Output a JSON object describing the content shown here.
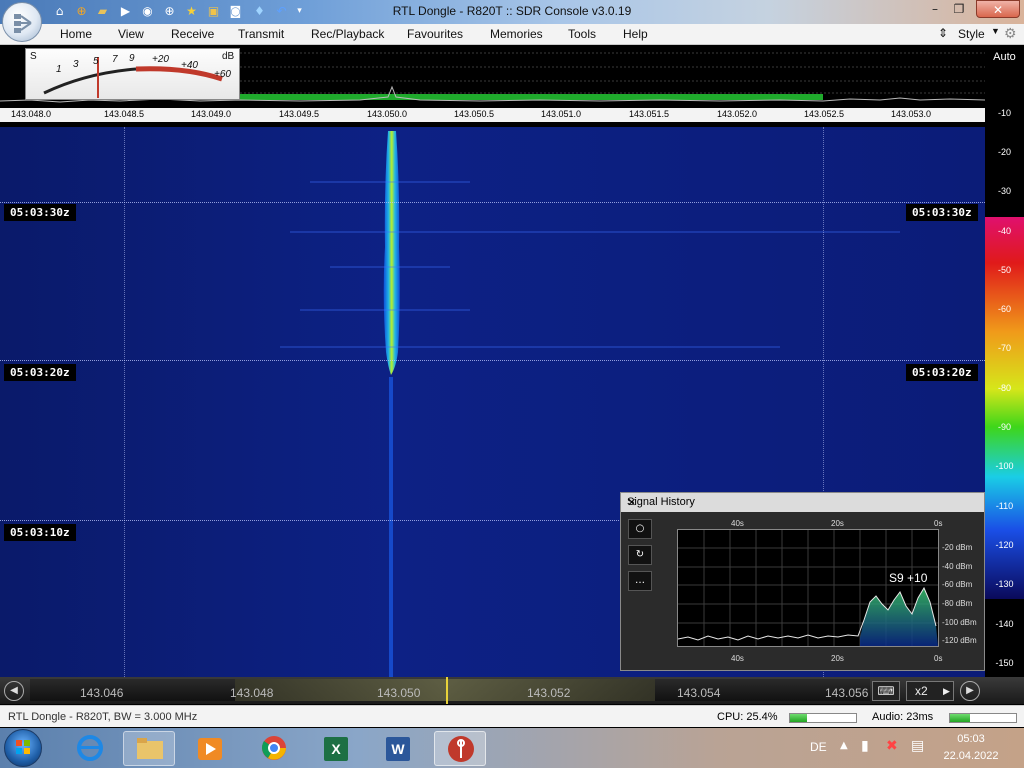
{
  "window": {
    "title": "RTL Dongle - R820T :: SDR Console v3.0.19",
    "controls": [
      "minimize",
      "restore",
      "close"
    ]
  },
  "quick_access_icons": [
    "home-icon",
    "help-icon",
    "folder-icon",
    "play-icon",
    "stop-icon",
    "add-icon",
    "star-icon",
    "lock-icon",
    "camera-icon",
    "antenna-icon",
    "undo-icon",
    "dropdown-icon"
  ],
  "menu": {
    "items": [
      "Home",
      "View",
      "Receive",
      "Transmit",
      "Rec/Playback",
      "Favourites",
      "Memories",
      "Tools",
      "Help"
    ],
    "style_label": "Style"
  },
  "smeter": {
    "s_label": "S",
    "db_label": "dB",
    "ticks": [
      "1",
      "3",
      "5",
      "7",
      "9",
      "+20",
      "+40",
      "+60"
    ]
  },
  "spectrum": {
    "freq_ticks": [
      "143.048.0",
      "143.048.5",
      "143.049.0",
      "143.049.5",
      "143.050.0",
      "143.050.5",
      "143.051.0",
      "143.051.5",
      "143.052.0",
      "143.052.5",
      "143.053.0"
    ]
  },
  "db_scale": {
    "auto_label": "Auto",
    "labels": [
      "-10",
      "-20",
      "-30",
      "-40",
      "-50",
      "-60",
      "-70",
      "-80",
      "-90",
      "-100",
      "-110",
      "-120",
      "-130",
      "-140",
      "-150"
    ]
  },
  "waterfall": {
    "timestamps": [
      "05:03:30z",
      "05:03:20z",
      "05:03:10z"
    ]
  },
  "signal_history": {
    "title": "Signal History",
    "time_labels": [
      "40s",
      "20s",
      "0s"
    ],
    "dbm_labels": [
      "-20 dBm",
      "-40 dBm",
      "-60 dBm",
      "-80 dBm",
      "-100 dBm",
      "-120 dBm"
    ],
    "reading": "S9 +10",
    "side_buttons": [
      "circle-icon",
      "refresh-icon",
      "more-icon"
    ]
  },
  "bottom_bar": {
    "freqs": [
      "143.046",
      "143.048",
      "143.050",
      "143.052",
      "143.054",
      "143.056"
    ],
    "zoom": "x2"
  },
  "status": {
    "left": "RTL Dongle - R820T, BW = 3.000 MHz",
    "cpu": "CPU: 25.4%",
    "cpu_level": 0.254,
    "audio": "Audio: 23ms",
    "audio_level": 0.3
  },
  "taskbar": {
    "lang": "DE",
    "time": "05:03",
    "date": "22.04.2022",
    "apps": [
      "internet-explorer-icon",
      "file-explorer-icon",
      "media-player-icon",
      "chrome-icon",
      "excel-icon",
      "word-icon",
      "sdr-console-icon"
    ]
  }
}
